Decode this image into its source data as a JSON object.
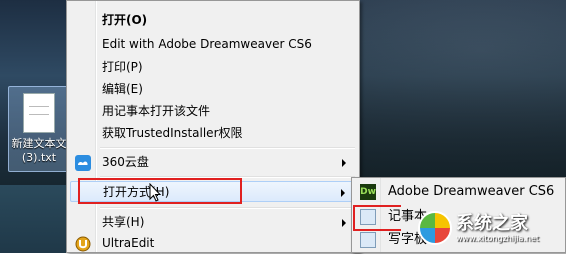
{
  "desktop": {
    "file_icon_label_line1": "新建文本文",
    "file_icon_label_line2": "(3).txt"
  },
  "context_menu": {
    "items": [
      {
        "label": "打开(O)",
        "bold": true
      },
      {
        "label": "Edit with Adobe Dreamweaver CS6"
      },
      {
        "label": "打印(P)"
      },
      {
        "label": "编辑(E)"
      },
      {
        "label": "用记事本打开该文件"
      },
      {
        "label": "获取TrustedInstaller权限"
      },
      {
        "label": "360云盘"
      },
      {
        "label": "打开方式(H)"
      },
      {
        "label": "共享(H)"
      },
      {
        "label": "UltraEdit"
      }
    ]
  },
  "submenu": {
    "items": [
      {
        "label": "Adobe Dreamweaver CS6"
      },
      {
        "label": "记事本"
      },
      {
        "label": "写字板"
      }
    ]
  },
  "watermark": {
    "title": "系统之家",
    "url": "www.xitongzhijia.net"
  },
  "colors": {
    "highlight_box": "#e02020",
    "menu_bg": "#f0f0f0",
    "menu_border": "#979797"
  }
}
